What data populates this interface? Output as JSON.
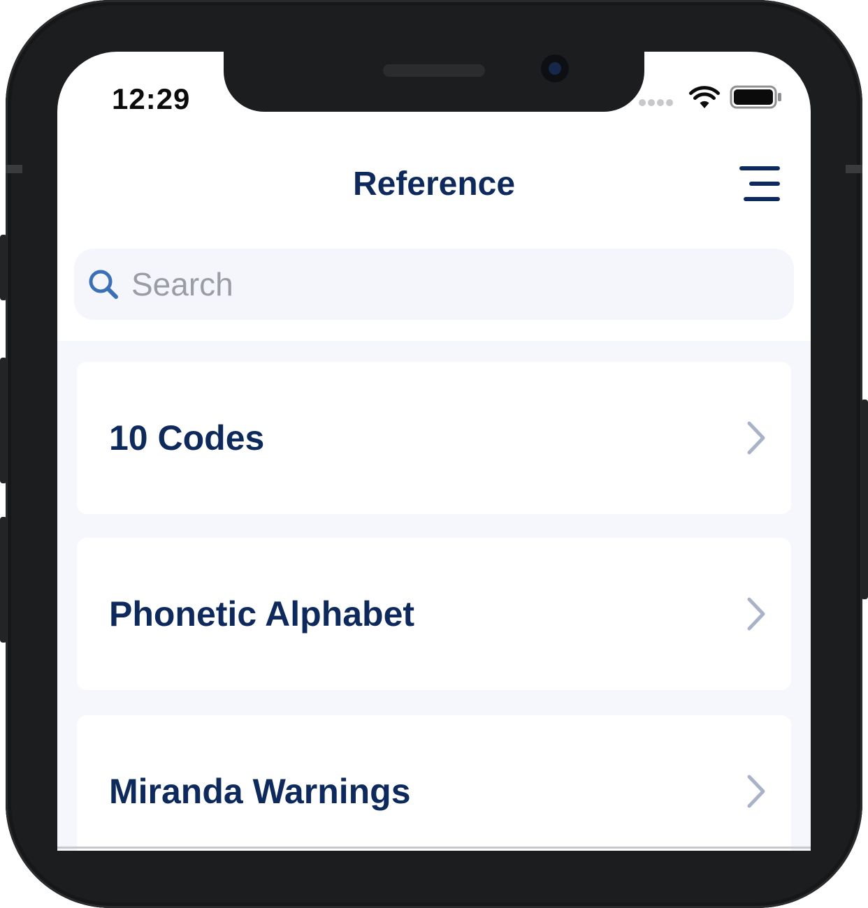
{
  "status_bar": {
    "time": "12:29"
  },
  "header": {
    "title": "Reference"
  },
  "search": {
    "placeholder": "Search",
    "value": ""
  },
  "list": {
    "items": [
      {
        "label": "10 Codes"
      },
      {
        "label": "Phonetic Alphabet"
      },
      {
        "label": "Miranda Warnings"
      }
    ]
  },
  "icons": {
    "menu": "hamburger-menu-icon",
    "search": "search-icon",
    "row_arrow": "chevron-right-icon",
    "wifi": "wifi-icon",
    "battery": "battery-icon"
  },
  "colors": {
    "primary_navy": "#0e2a5c",
    "search_icon_blue": "#3b6fb6",
    "chevron_gray": "#a9b3c8",
    "list_background": "#f5f7fc",
    "search_background": "#f4f6fb"
  }
}
